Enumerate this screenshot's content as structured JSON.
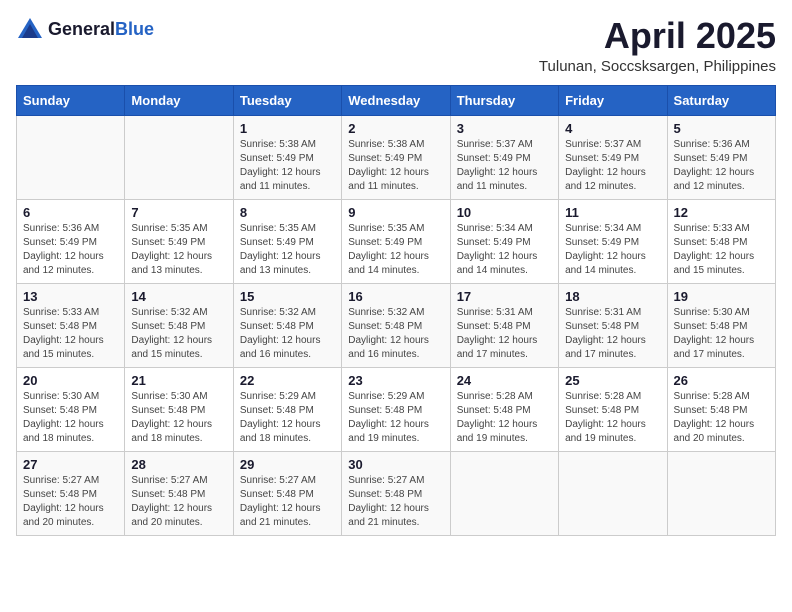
{
  "header": {
    "logo_general": "General",
    "logo_blue": "Blue",
    "title": "April 2025",
    "subtitle": "Tulunan, Soccsksargen, Philippines"
  },
  "weekdays": [
    "Sunday",
    "Monday",
    "Tuesday",
    "Wednesday",
    "Thursday",
    "Friday",
    "Saturday"
  ],
  "weeks": [
    [
      {
        "day": "",
        "sunrise": "",
        "sunset": "",
        "daylight": ""
      },
      {
        "day": "",
        "sunrise": "",
        "sunset": "",
        "daylight": ""
      },
      {
        "day": "1",
        "sunrise": "Sunrise: 5:38 AM",
        "sunset": "Sunset: 5:49 PM",
        "daylight": "Daylight: 12 hours and 11 minutes."
      },
      {
        "day": "2",
        "sunrise": "Sunrise: 5:38 AM",
        "sunset": "Sunset: 5:49 PM",
        "daylight": "Daylight: 12 hours and 11 minutes."
      },
      {
        "day": "3",
        "sunrise": "Sunrise: 5:37 AM",
        "sunset": "Sunset: 5:49 PM",
        "daylight": "Daylight: 12 hours and 11 minutes."
      },
      {
        "day": "4",
        "sunrise": "Sunrise: 5:37 AM",
        "sunset": "Sunset: 5:49 PM",
        "daylight": "Daylight: 12 hours and 12 minutes."
      },
      {
        "day": "5",
        "sunrise": "Sunrise: 5:36 AM",
        "sunset": "Sunset: 5:49 PM",
        "daylight": "Daylight: 12 hours and 12 minutes."
      }
    ],
    [
      {
        "day": "6",
        "sunrise": "Sunrise: 5:36 AM",
        "sunset": "Sunset: 5:49 PM",
        "daylight": "Daylight: 12 hours and 12 minutes."
      },
      {
        "day": "7",
        "sunrise": "Sunrise: 5:35 AM",
        "sunset": "Sunset: 5:49 PM",
        "daylight": "Daylight: 12 hours and 13 minutes."
      },
      {
        "day": "8",
        "sunrise": "Sunrise: 5:35 AM",
        "sunset": "Sunset: 5:49 PM",
        "daylight": "Daylight: 12 hours and 13 minutes."
      },
      {
        "day": "9",
        "sunrise": "Sunrise: 5:35 AM",
        "sunset": "Sunset: 5:49 PM",
        "daylight": "Daylight: 12 hours and 14 minutes."
      },
      {
        "day": "10",
        "sunrise": "Sunrise: 5:34 AM",
        "sunset": "Sunset: 5:49 PM",
        "daylight": "Daylight: 12 hours and 14 minutes."
      },
      {
        "day": "11",
        "sunrise": "Sunrise: 5:34 AM",
        "sunset": "Sunset: 5:49 PM",
        "daylight": "Daylight: 12 hours and 14 minutes."
      },
      {
        "day": "12",
        "sunrise": "Sunrise: 5:33 AM",
        "sunset": "Sunset: 5:48 PM",
        "daylight": "Daylight: 12 hours and 15 minutes."
      }
    ],
    [
      {
        "day": "13",
        "sunrise": "Sunrise: 5:33 AM",
        "sunset": "Sunset: 5:48 PM",
        "daylight": "Daylight: 12 hours and 15 minutes."
      },
      {
        "day": "14",
        "sunrise": "Sunrise: 5:32 AM",
        "sunset": "Sunset: 5:48 PM",
        "daylight": "Daylight: 12 hours and 15 minutes."
      },
      {
        "day": "15",
        "sunrise": "Sunrise: 5:32 AM",
        "sunset": "Sunset: 5:48 PM",
        "daylight": "Daylight: 12 hours and 16 minutes."
      },
      {
        "day": "16",
        "sunrise": "Sunrise: 5:32 AM",
        "sunset": "Sunset: 5:48 PM",
        "daylight": "Daylight: 12 hours and 16 minutes."
      },
      {
        "day": "17",
        "sunrise": "Sunrise: 5:31 AM",
        "sunset": "Sunset: 5:48 PM",
        "daylight": "Daylight: 12 hours and 17 minutes."
      },
      {
        "day": "18",
        "sunrise": "Sunrise: 5:31 AM",
        "sunset": "Sunset: 5:48 PM",
        "daylight": "Daylight: 12 hours and 17 minutes."
      },
      {
        "day": "19",
        "sunrise": "Sunrise: 5:30 AM",
        "sunset": "Sunset: 5:48 PM",
        "daylight": "Daylight: 12 hours and 17 minutes."
      }
    ],
    [
      {
        "day": "20",
        "sunrise": "Sunrise: 5:30 AM",
        "sunset": "Sunset: 5:48 PM",
        "daylight": "Daylight: 12 hours and 18 minutes."
      },
      {
        "day": "21",
        "sunrise": "Sunrise: 5:30 AM",
        "sunset": "Sunset: 5:48 PM",
        "daylight": "Daylight: 12 hours and 18 minutes."
      },
      {
        "day": "22",
        "sunrise": "Sunrise: 5:29 AM",
        "sunset": "Sunset: 5:48 PM",
        "daylight": "Daylight: 12 hours and 18 minutes."
      },
      {
        "day": "23",
        "sunrise": "Sunrise: 5:29 AM",
        "sunset": "Sunset: 5:48 PM",
        "daylight": "Daylight: 12 hours and 19 minutes."
      },
      {
        "day": "24",
        "sunrise": "Sunrise: 5:28 AM",
        "sunset": "Sunset: 5:48 PM",
        "daylight": "Daylight: 12 hours and 19 minutes."
      },
      {
        "day": "25",
        "sunrise": "Sunrise: 5:28 AM",
        "sunset": "Sunset: 5:48 PM",
        "daylight": "Daylight: 12 hours and 19 minutes."
      },
      {
        "day": "26",
        "sunrise": "Sunrise: 5:28 AM",
        "sunset": "Sunset: 5:48 PM",
        "daylight": "Daylight: 12 hours and 20 minutes."
      }
    ],
    [
      {
        "day": "27",
        "sunrise": "Sunrise: 5:27 AM",
        "sunset": "Sunset: 5:48 PM",
        "daylight": "Daylight: 12 hours and 20 minutes."
      },
      {
        "day": "28",
        "sunrise": "Sunrise: 5:27 AM",
        "sunset": "Sunset: 5:48 PM",
        "daylight": "Daylight: 12 hours and 20 minutes."
      },
      {
        "day": "29",
        "sunrise": "Sunrise: 5:27 AM",
        "sunset": "Sunset: 5:48 PM",
        "daylight": "Daylight: 12 hours and 21 minutes."
      },
      {
        "day": "30",
        "sunrise": "Sunrise: 5:27 AM",
        "sunset": "Sunset: 5:48 PM",
        "daylight": "Daylight: 12 hours and 21 minutes."
      },
      {
        "day": "",
        "sunrise": "",
        "sunset": "",
        "daylight": ""
      },
      {
        "day": "",
        "sunrise": "",
        "sunset": "",
        "daylight": ""
      },
      {
        "day": "",
        "sunrise": "",
        "sunset": "",
        "daylight": ""
      }
    ]
  ]
}
